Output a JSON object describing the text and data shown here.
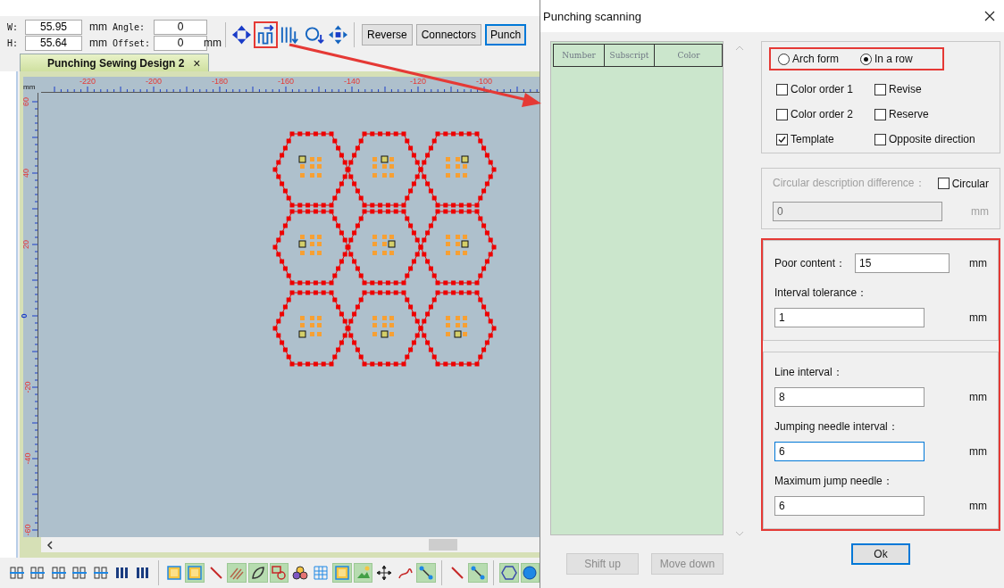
{
  "toolbar": {
    "fields": [
      {
        "label": "W:",
        "value": "55.95",
        "unit": "mm",
        "param_label": "Angle:",
        "param_value": "0"
      },
      {
        "label": "H:",
        "value": "55.64",
        "unit": "mm",
        "param_label": "Offset:",
        "param_value": "0",
        "param_unit": "mm"
      }
    ],
    "tools": [
      {
        "kind": "move",
        "annotated": false
      },
      {
        "kind": "scan",
        "annotated": true
      },
      {
        "kind": "columns",
        "annotated": false
      },
      {
        "kind": "circle",
        "annotated": false
      },
      {
        "kind": "center",
        "annotated": false
      }
    ],
    "buttons": [
      {
        "label": "Reverse",
        "selected": false
      },
      {
        "label": "Connectors",
        "selected": false
      },
      {
        "label": "Punch",
        "selected": true
      }
    ]
  },
  "document_tab": {
    "title": "Punching Sewing Design 2",
    "close": "×"
  },
  "ruler": {
    "unit": "mm",
    "x_labels": [
      "-220",
      "-200",
      "-180",
      "-160",
      "-140",
      "-120",
      "-100"
    ],
    "y_labels": [
      "60",
      "40",
      "20",
      "0",
      "-20",
      "-40",
      "-60"
    ]
  },
  "bottom_toolbar": [
    {
      "kind": "align",
      "active": false
    },
    {
      "kind": "align",
      "active": false
    },
    {
      "kind": "align",
      "active": false
    },
    {
      "kind": "align",
      "active": false
    },
    {
      "kind": "align",
      "active": false
    },
    {
      "kind": "bars",
      "active": false
    },
    {
      "kind": "bars",
      "active": false
    },
    {
      "kind": "separator"
    },
    {
      "kind": "frame",
      "active": false
    },
    {
      "kind": "frame",
      "active": true
    },
    {
      "kind": "line",
      "active": false
    },
    {
      "kind": "hatch",
      "active": true
    },
    {
      "kind": "leaf",
      "active": true
    },
    {
      "kind": "shapes",
      "active": true
    },
    {
      "kind": "balls",
      "active": false
    },
    {
      "kind": "grid",
      "active": false
    },
    {
      "kind": "frame",
      "active": true
    },
    {
      "kind": "landscape",
      "active": true
    },
    {
      "kind": "move",
      "active": false
    },
    {
      "kind": "curve",
      "active": false
    },
    {
      "kind": "node",
      "active": true
    },
    {
      "kind": "separator"
    },
    {
      "kind": "line",
      "active": false
    },
    {
      "kind": "node",
      "active": true
    },
    {
      "kind": "separator"
    },
    {
      "kind": "hexagon",
      "active": true
    },
    {
      "kind": "circle",
      "active": true
    }
  ],
  "dialog": {
    "title": "Punching scanning",
    "list": {
      "columns": [
        "Number",
        "Subscript",
        "Color"
      ]
    },
    "mode": [
      {
        "label": "Arch form",
        "selected": false
      },
      {
        "label": "In a row",
        "selected": true
      }
    ],
    "options": [
      {
        "label": "Color order 1",
        "checked": false
      },
      {
        "label": "Revise",
        "checked": false
      },
      {
        "label": "Color order 2",
        "checked": false
      },
      {
        "label": "Reserve",
        "checked": false
      },
      {
        "label": "Template",
        "checked": true
      },
      {
        "label": "Opposite direction",
        "checked": false
      }
    ],
    "circular": {
      "label": "Circular description difference：",
      "disabled": true,
      "checkbox": {
        "label": "Circular",
        "checked": false
      },
      "value": "0",
      "unit": "mm"
    },
    "tolerance_group": [
      {
        "kind": "inline",
        "label": "Poor content：",
        "value": "15",
        "unit": "mm",
        "focused": false
      },
      {
        "kind": "stacked",
        "label": "Interval tolerance：",
        "value": "1",
        "unit": "mm",
        "focused": false
      }
    ],
    "needle_group": [
      {
        "kind": "stacked",
        "label": "Line interval：",
        "value": "8",
        "unit": "mm",
        "focused": false
      },
      {
        "kind": "stacked",
        "label": "Jumping needle interval：",
        "value": "6",
        "unit": "mm",
        "focused": true
      },
      {
        "kind": "stacked",
        "label": "Maximum jump needle：",
        "value": "6",
        "unit": "mm",
        "focused": false
      }
    ],
    "buttons": [
      {
        "label": "Shift up",
        "disabled": true
      },
      {
        "label": "Move down",
        "disabled": true
      },
      {
        "label": "Ok",
        "disabled": false
      }
    ]
  }
}
